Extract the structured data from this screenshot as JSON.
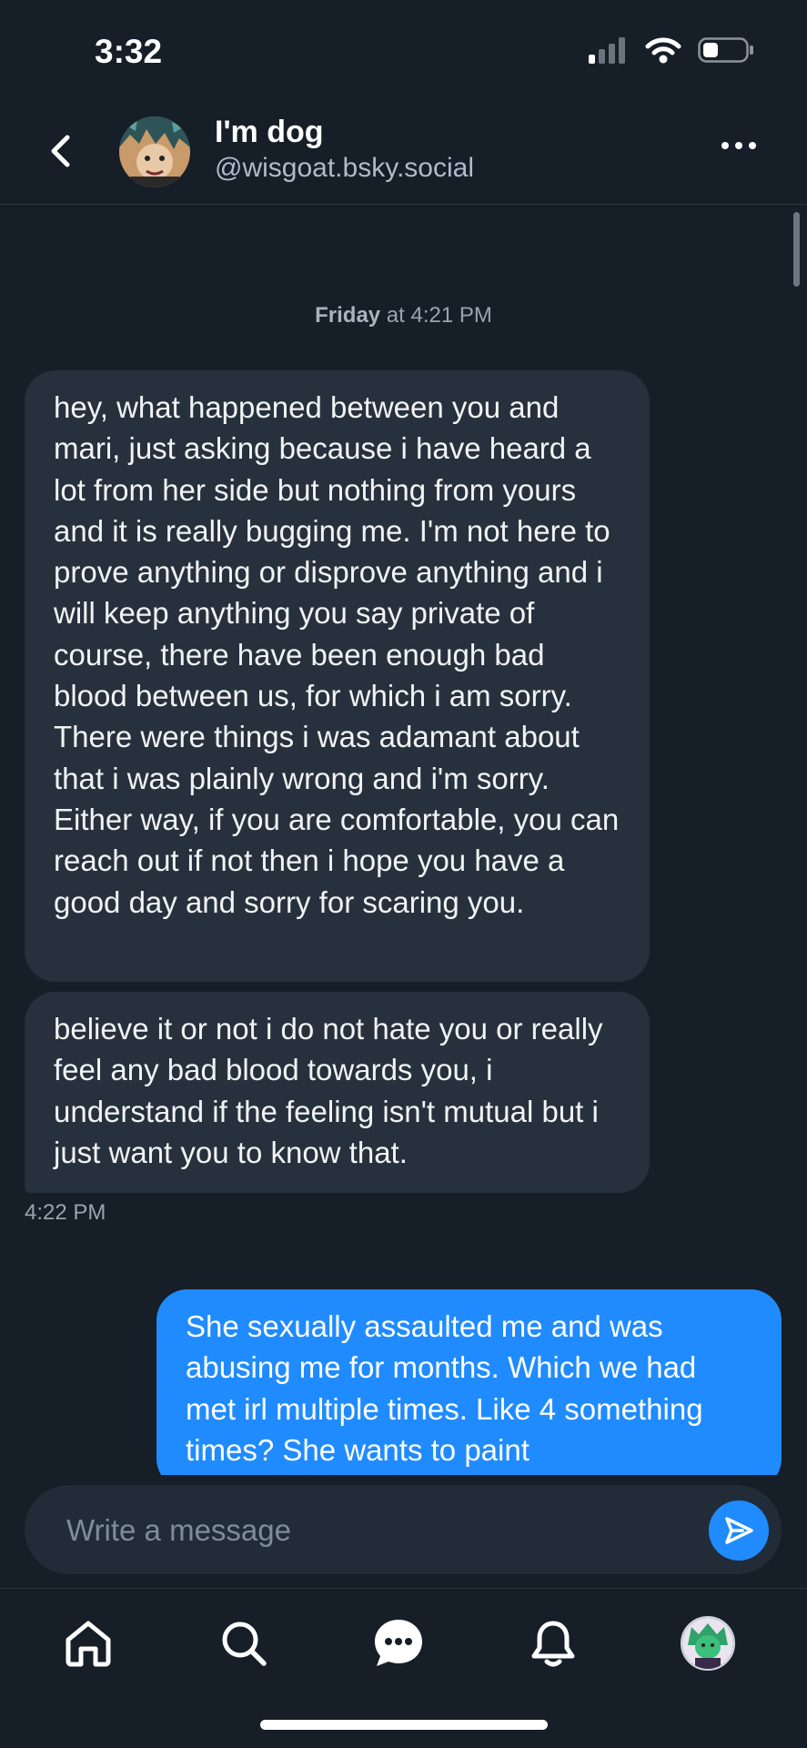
{
  "status_bar": {
    "time": "3:32"
  },
  "header": {
    "name": "I'm dog",
    "handle": "@wisgoat.bsky.social"
  },
  "conversation": {
    "date_day": "Friday",
    "date_rest": " at 4:21 PM",
    "messages": [
      {
        "from": "them",
        "text": "hey, what happened between you and mari, just asking because i have heard a lot from her side but nothing from yours and it is really bugging me. I'm not here to prove anything or disprove anything and i will keep anything you say private of course, there have been enough bad blood between us, for which i am sorry. There were things i was adamant about that i was plainly wrong and i'm sorry. Either way, if you are comfortable, you can reach out if not then i hope you have a good day and sorry for scaring you."
      },
      {
        "from": "them",
        "text": "believe it or not i do not hate you or really feel any bad blood towards you, i understand if the feeling isn't mutual but i just want you to know that.",
        "time": "4:22 PM"
      },
      {
        "from": "me",
        "text": "She sexually assaulted me and was abusing me for months. Which we had met irl multiple times. Like 4 something times? She wants to paint"
      }
    ]
  },
  "composer": {
    "placeholder": "Write a message"
  },
  "tabs": [
    "home-icon",
    "search-icon",
    "chat-icon",
    "bell-icon",
    "profile-avatar"
  ],
  "colors": {
    "background": "#161e27",
    "incoming_bubble": "#27313d",
    "outgoing_bubble": "#208bfe",
    "muted_text": "#98a4b1"
  }
}
